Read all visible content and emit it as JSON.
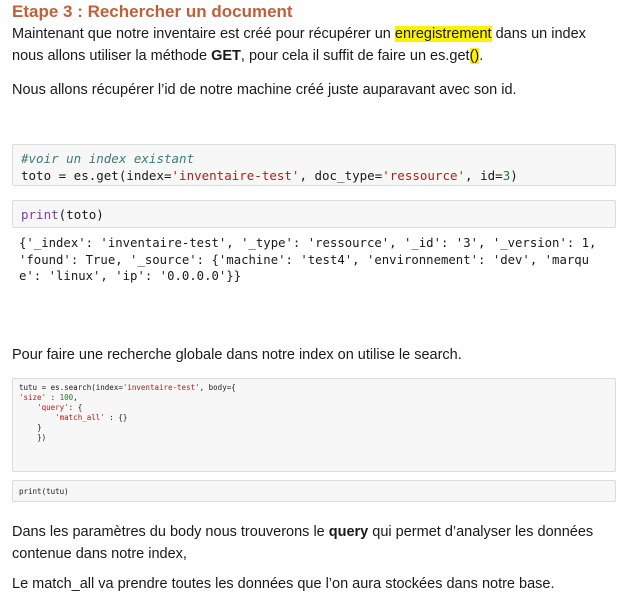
{
  "heading": "Etape 3 : Rechercher un document",
  "intro": {
    "part1": "Maintenant que notre inventaire est créé pour récupérer un ",
    "highlight": "enregistrement",
    "part2": " dans un index nous allons utiliser la méthode ",
    "bold": "GET",
    "part3": ",  pour cela il suffit de faire un es.get",
    "highlight_parens": "()",
    "part4": "."
  },
  "para_id": "Nous allons récupérer l’id de notre machine créé juste auparavant avec son id.",
  "code_get": {
    "comment": "#voir un index existant",
    "line2_a": "toto = es.get(index=",
    "line2_str1": "'inventaire-test'",
    "line2_b": ", doc_type=",
    "line2_str2": "'ressource'",
    "line2_c": ", id=",
    "line2_num": "3",
    "line2_d": ")"
  },
  "code_print_toto": {
    "fn": "print",
    "arg": "(toto)"
  },
  "output_lines": [
    "{'_index': 'inventaire-test', '_type': 'ressource', '_id': '3', '_version': 1,",
    "'found': True, '_source': {'machine': 'test4', 'environnement': 'dev', 'marqu",
    "e': 'linux', 'ip': '0.0.0.0'}}"
  ],
  "para_search": "Pour faire une recherche globale dans notre index on utilise le search.",
  "code_search": {
    "l1_a": "tutu = es.search(index=",
    "l1_str": "'inventaire-test'",
    "l1_b": ", body={",
    "l2_str": "'size'",
    "l2_b": " : ",
    "l2_num": "100",
    "l2_c": ",",
    "l3_str": "'query'",
    "l3_b": ": {",
    "l4_str": "'match_all'",
    "l4_b": " : {}",
    "l5": "}",
    "l6": "})"
  },
  "code_print_tutu": "print(tutu)",
  "para_body": {
    "part1": "Dans les paramètres du body nous trouverons le ",
    "bold": "query",
    "part2": " qui permet d’analyser les données contenue dans notre index,"
  },
  "para_match": "Le match_all va prendre toutes les données que l’on aura stockées dans notre base."
}
